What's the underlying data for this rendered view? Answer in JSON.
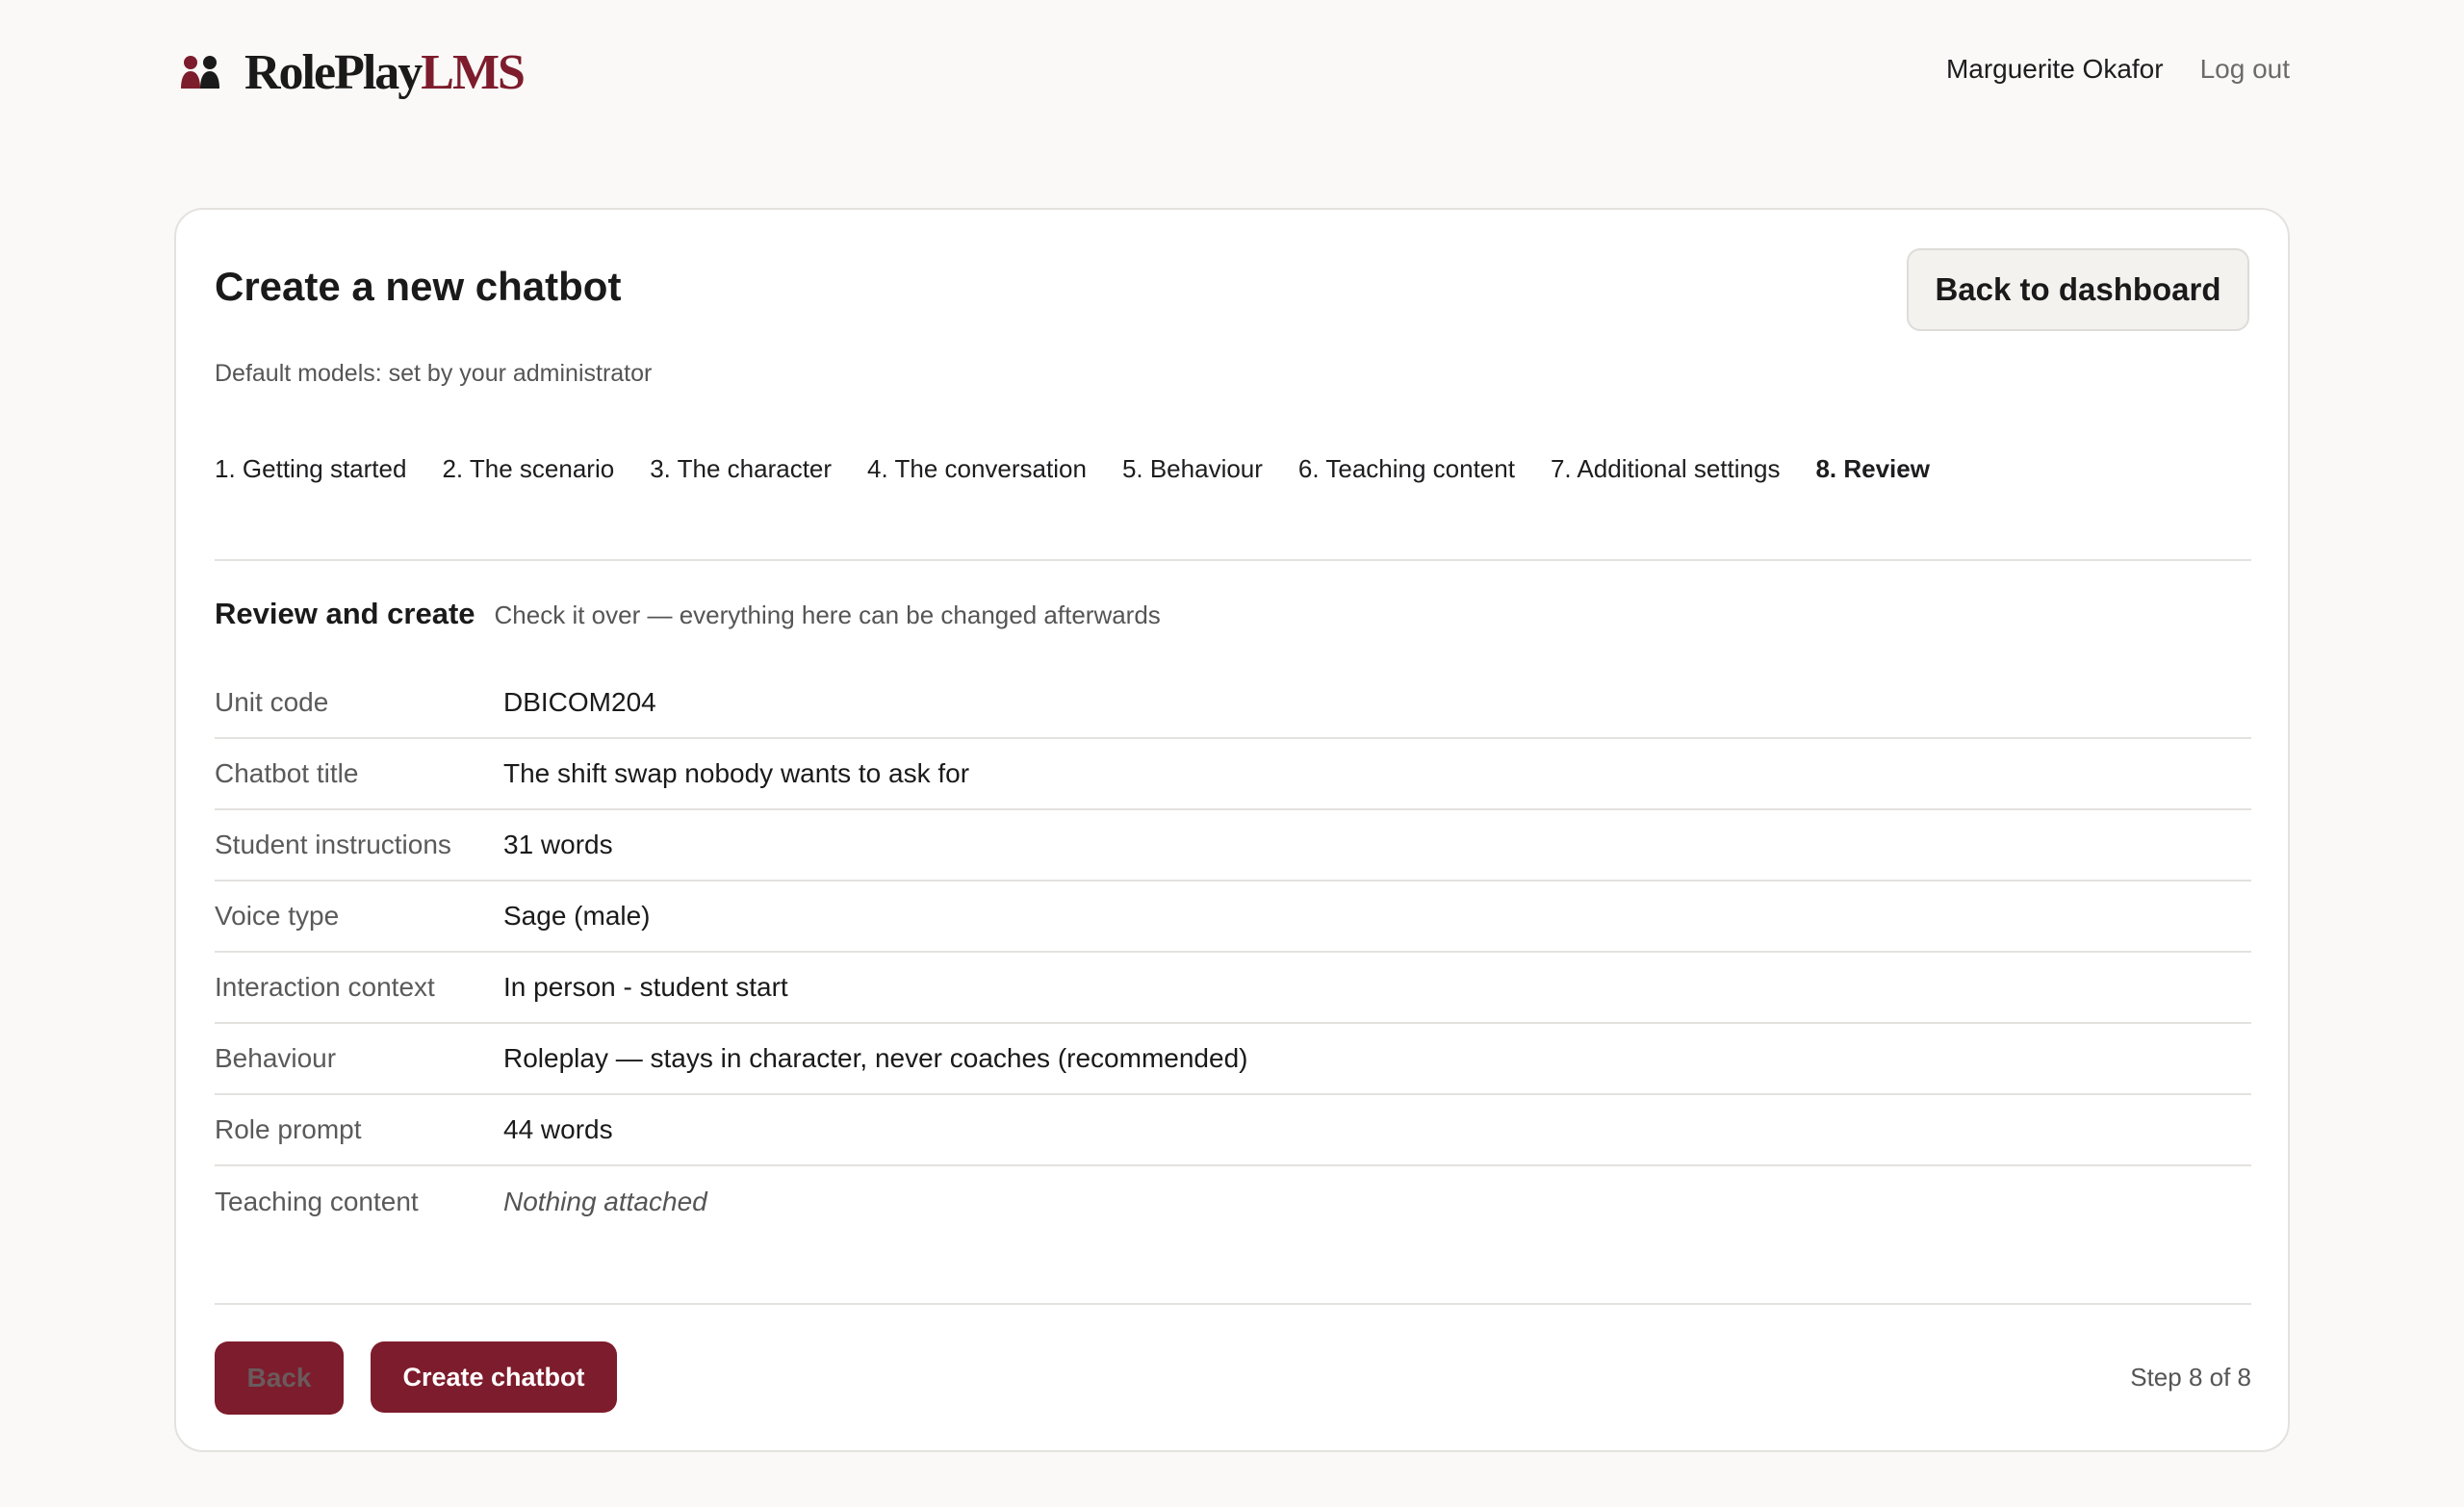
{
  "brand": {
    "name_part1": "RolePlay",
    "name_part2": "LMS",
    "icon": "two-people-icon",
    "accent_color": "#7d1c2c"
  },
  "header": {
    "user_name": "Marguerite Okafor",
    "logout_label": "Log out"
  },
  "page": {
    "title": "Create a new chatbot",
    "back_to_dashboard_label": "Back to dashboard",
    "subtitle": "Default models: set by your administrator"
  },
  "steps": [
    {
      "label": "1. Getting started",
      "active": false
    },
    {
      "label": "2. The scenario",
      "active": false
    },
    {
      "label": "3. The character",
      "active": false
    },
    {
      "label": "4. The conversation",
      "active": false
    },
    {
      "label": "5. Behaviour",
      "active": false
    },
    {
      "label": "6. Teaching content",
      "active": false
    },
    {
      "label": "7. Additional settings",
      "active": false
    },
    {
      "label": "8. Review",
      "active": true
    }
  ],
  "review": {
    "title": "Review and create",
    "subtitle": "Check it over — everything here can be changed afterwards",
    "rows": [
      {
        "label": "Unit code",
        "value": "DBICOM204"
      },
      {
        "label": "Chatbot title",
        "value": "The shift swap nobody wants to ask for"
      },
      {
        "label": "Student instructions",
        "value": "31 words"
      },
      {
        "label": "Voice type",
        "value": "Sage (male)"
      },
      {
        "label": "Interaction context",
        "value": "In person - student start"
      },
      {
        "label": "Behaviour",
        "value": "Roleplay — stays in character, never coaches (recommended)"
      },
      {
        "label": "Role prompt",
        "value": "44 words"
      },
      {
        "label": "Teaching content",
        "value": "Nothing attached"
      }
    ]
  },
  "footer": {
    "back_label": "Back",
    "create_label": "Create chatbot",
    "step_counter": "Step 8 of 8"
  }
}
